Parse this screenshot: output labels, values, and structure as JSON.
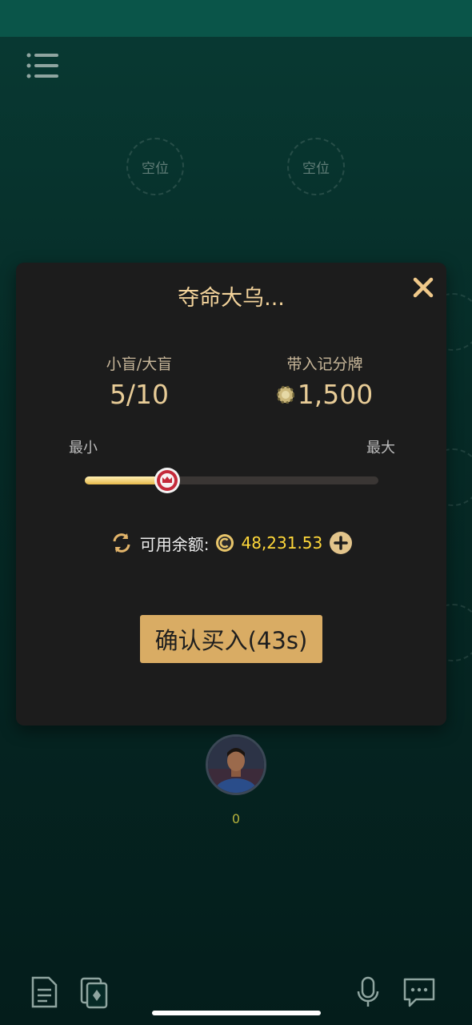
{
  "table": {
    "seats": [
      {
        "label": "空位"
      },
      {
        "label": "空位"
      }
    ],
    "player": {
      "score": "0"
    }
  },
  "modal": {
    "title": "夺命大乌...",
    "blinds_label": "小盲/大盲",
    "blinds_value": "5/10",
    "buyin_label": "带入记分牌",
    "buyin_value": "1,500",
    "min_label": "最小",
    "max_label": "最大",
    "slider_fraction": 0.28,
    "balance_label": "可用余额:",
    "balance_value": "48,231.53",
    "confirm_label": "确认买入(43s)"
  },
  "icons": [
    "menu-icon",
    "close-icon",
    "chip-icon",
    "refresh-icon",
    "coin-icon",
    "plus-icon",
    "document-icon",
    "cards-icon",
    "microphone-icon",
    "chat-icon"
  ],
  "colors": {
    "accent_gold": "#d9ac64",
    "title_gold": "#f3d39b",
    "balance_yellow": "#ffd83a",
    "modal_bg": "#1c1c1c",
    "table_green": "#083a33"
  }
}
